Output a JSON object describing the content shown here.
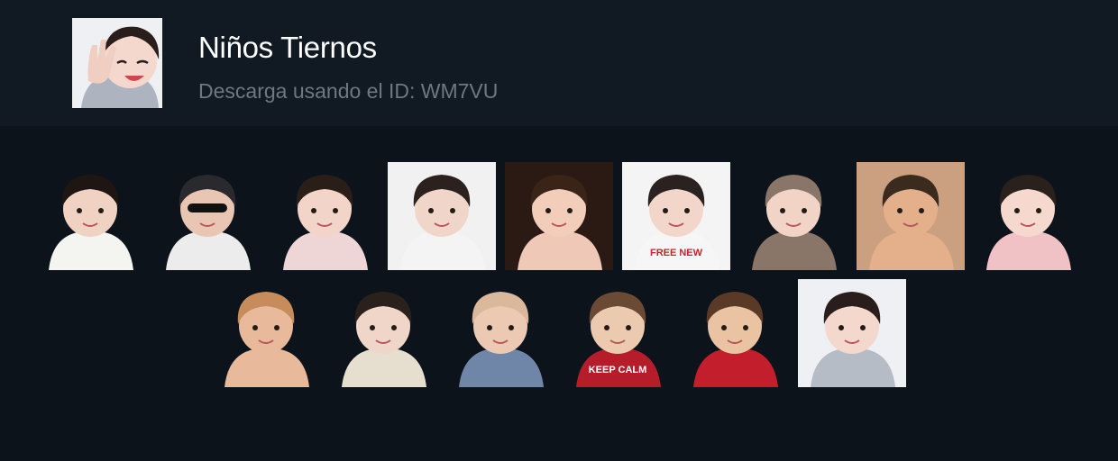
{
  "pack": {
    "title": "Niños Tiernos",
    "subtitle": "Descarga usando el ID: WM7VU",
    "thumbnail": "waving-child-sticker"
  },
  "stickers": [
    {
      "name": "sticker-boy-staring",
      "bg": "transparent",
      "skin": "#f0d2c2",
      "hair": "#1e1612",
      "shirt": "#f4f4f0",
      "text": ""
    },
    {
      "name": "sticker-boy-sunglasses-thumbs-up",
      "bg": "transparent",
      "skin": "#e9c5b3",
      "hair": "#2a2a2e",
      "shirt": "#ececec",
      "text": ""
    },
    {
      "name": "sticker-girl-heart-hands",
      "bg": "transparent",
      "skin": "#f2d4c8",
      "hair": "#2a1e18",
      "shirt": "#eed6d6",
      "text": ""
    },
    {
      "name": "sticker-girl-smiling-bob",
      "bg": "#f1f1f1",
      "skin": "#f0d6c8",
      "hair": "#2b2220",
      "shirt": "#f4f4f4",
      "text": ""
    },
    {
      "name": "sticker-girl-pouting",
      "bg": "#2b1a14",
      "skin": "#f2cdb9",
      "hair": "#3a2418",
      "shirt": "#f0c8b8",
      "text": ""
    },
    {
      "name": "sticker-girl-free-shirt",
      "bg": "#f4f4f4",
      "skin": "#f1d6c9",
      "hair": "#2a2220",
      "shirt": "#f6f6f6",
      "text": "FREE NEW"
    },
    {
      "name": "sticker-child-bear-hat-heart",
      "bg": "transparent",
      "skin": "#f1d4c6",
      "hair": "#8a7668",
      "shirt": "#8a7668",
      "text": ""
    },
    {
      "name": "sticker-baby-closeup-smile",
      "bg": "#caa080",
      "skin": "#e4b08c",
      "hair": "#3b2a1e",
      "shirt": "#e4b08c",
      "text": ""
    },
    {
      "name": "sticker-girl-pink-hood",
      "bg": "transparent",
      "skin": "#f5d9cf",
      "hair": "#2a201c",
      "shirt": "#f0c2c6",
      "text": ""
    },
    {
      "name": "sticker-baby-smirk",
      "bg": "transparent",
      "skin": "#e8b99a",
      "hair": "#c68c5c",
      "shirt": "#e8b99a",
      "text": ""
    },
    {
      "name": "sticker-girl-thumbs-up-beige",
      "bg": "transparent",
      "skin": "#f0d6c9",
      "hair": "#2a201c",
      "shirt": "#e6dfd0",
      "text": ""
    },
    {
      "name": "sticker-baby-sitting-sweater",
      "bg": "transparent",
      "skin": "#ecc9b2",
      "hair": "#d9b89c",
      "shirt": "#6f86a8",
      "text": ""
    },
    {
      "name": "sticker-boy-keep-calm",
      "bg": "transparent",
      "skin": "#eccaaf",
      "hair": "#6a4a34",
      "shirt": "#b51d2a",
      "text": "KEEP CALM"
    },
    {
      "name": "sticker-boy-grinning-red",
      "bg": "transparent",
      "skin": "#eac3a2",
      "hair": "#5a3a26",
      "shirt": "#c21e2c",
      "text": ""
    },
    {
      "name": "sticker-girl-waving",
      "bg": "#eef0f4",
      "skin": "#f4d8cd",
      "hair": "#2a1e1c",
      "shirt": "#b6bcc6",
      "text": ""
    }
  ]
}
